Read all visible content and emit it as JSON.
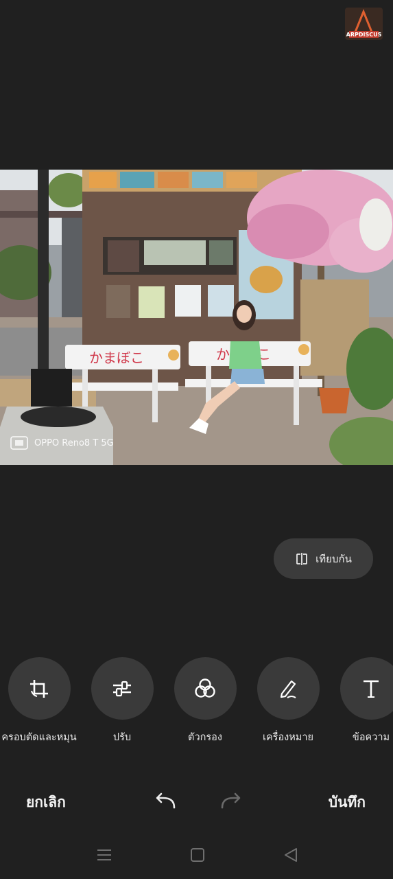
{
  "watermark": {
    "logo_text_top": "ARP",
    "logo_text_bottom": "ARPDISCUS"
  },
  "photo": {
    "watermark_text": "OPPO Reno8 T 5G",
    "sign_text": "かまぼこ"
  },
  "compare": {
    "label": "เทียบกัน",
    "icon": "compare-icon"
  },
  "tools": [
    {
      "label": "ครอบตัดและหมุน",
      "icon": "crop-rotate-icon"
    },
    {
      "label": "ปรับ",
      "icon": "adjust-sliders-icon"
    },
    {
      "label": "ตัวกรอง",
      "icon": "filter-icon"
    },
    {
      "label": "เครื่องหมาย",
      "icon": "markup-pen-icon"
    },
    {
      "label": "ข้อความ",
      "icon": "text-icon"
    }
  ],
  "actions": {
    "cancel_label": "ยกเลิก",
    "save_label": "บันทึก",
    "undo_icon": "undo-icon",
    "redo_icon": "redo-icon"
  },
  "nav": {
    "menu_icon": "menu-icon",
    "home_icon": "home-icon",
    "back_icon": "back-icon"
  },
  "colors": {
    "background": "#202020",
    "button_bg": "#3a3a3a",
    "text": "#eeeeee",
    "disabled_icon": "#6a6a6a"
  }
}
